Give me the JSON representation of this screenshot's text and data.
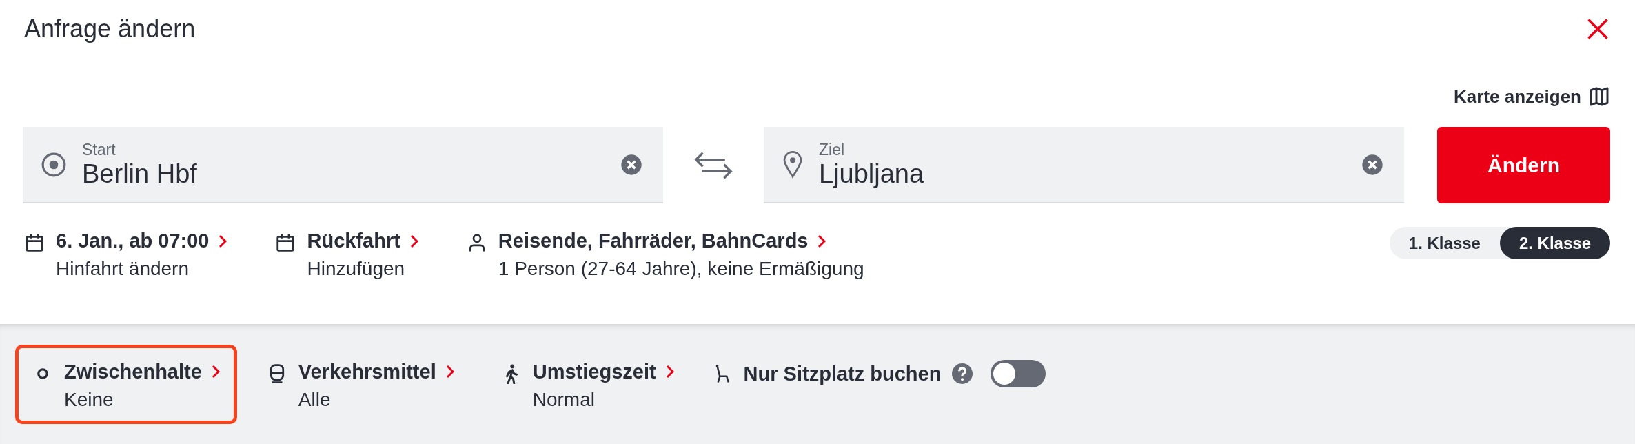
{
  "dialog": {
    "title": "Anfrage ändern"
  },
  "map_link": {
    "label": "Karte anzeigen"
  },
  "start": {
    "label": "Start",
    "value": "Berlin Hbf"
  },
  "destination": {
    "label": "Ziel",
    "value": "Ljubljana"
  },
  "submit": {
    "label": "Ändern"
  },
  "trip_options": [
    {
      "kind": "date",
      "title": "6. Jan., ab 07:00",
      "subtitle": "Hinfahrt ändern"
    },
    {
      "kind": "date",
      "title": "Rückfahrt",
      "subtitle": "Hinzufügen"
    },
    {
      "kind": "person",
      "title": "Reisende, Fahrräder, BahnCards",
      "subtitle": "1 Person (27-64 Jahre), keine Ermäßigung"
    }
  ],
  "classes": [
    {
      "label": "1. Klasse",
      "selected": false
    },
    {
      "label": "2. Klasse",
      "selected": true
    }
  ],
  "filters": [
    {
      "kind": "stops",
      "title": "Zwischenhalte",
      "subtitle": "Keine",
      "highlighted": true
    },
    {
      "kind": "train",
      "title": "Verkehrsmittel",
      "subtitle": "Alle",
      "highlighted": false
    },
    {
      "kind": "walk",
      "title": "Umstiegszeit",
      "subtitle": "Normal",
      "highlighted": false
    }
  ],
  "seat_only": {
    "label": "Nur Sitzplatz buchen",
    "on": false
  }
}
